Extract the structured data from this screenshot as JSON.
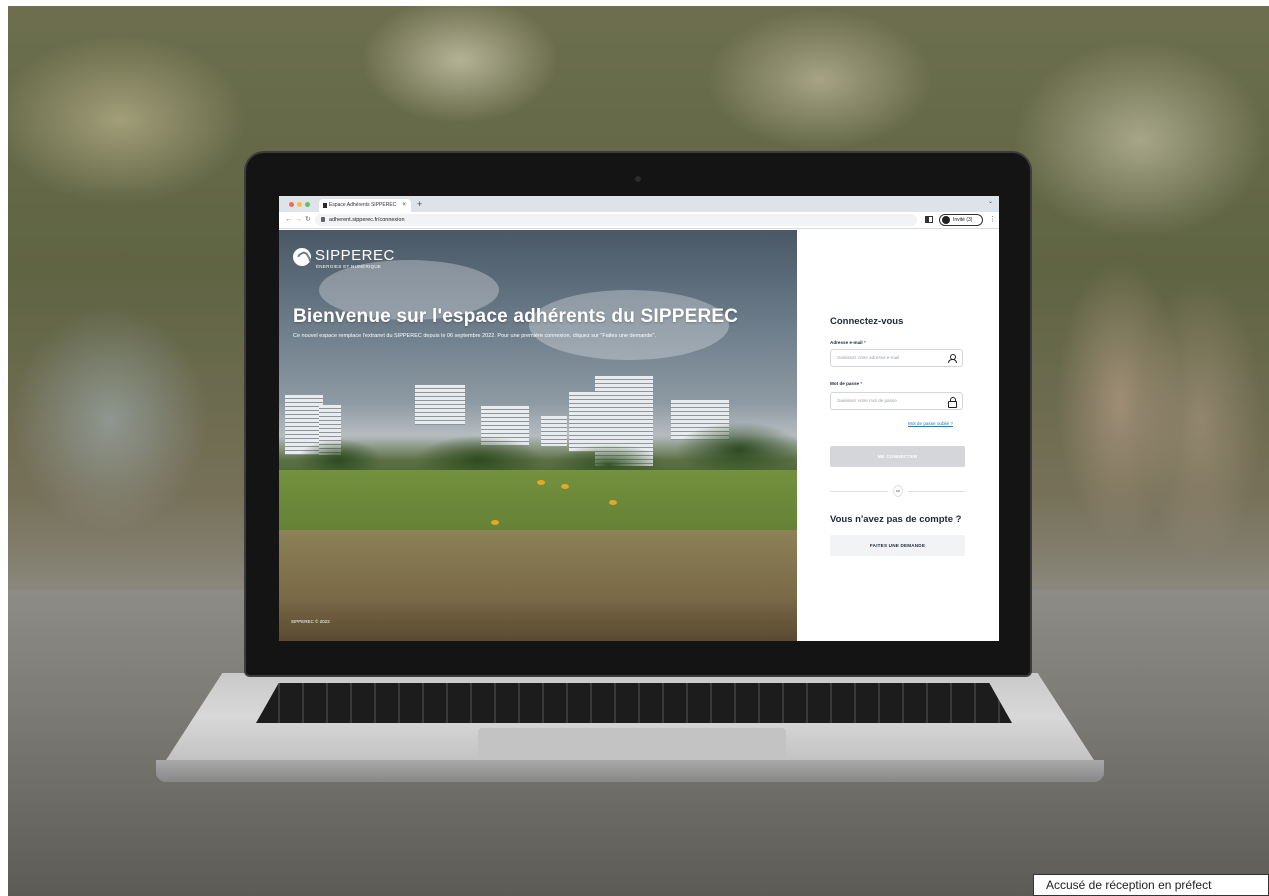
{
  "browser": {
    "tab_title": "Espace Adhérents SIPPEREC",
    "tab_close": "×",
    "new_tab": "+",
    "url": "adherent.sipperec.fr/connexion",
    "profile_label": "Invité (3)"
  },
  "hero": {
    "brand_name": "SIPPEREC",
    "brand_tagline": "ÉNERGIES ET NUMÉRIQUE",
    "title": "Bienvenue sur l'espace adhérents du SIPPEREC",
    "subtitle": "Ce nouvel espace remplace l'extranet du SIPPEREC depuis le 06 septembre 2022. Pour une première connexion, cliquez sur \"Faites une demande\".",
    "copyright": "SIPPEREC © 2023"
  },
  "login": {
    "title": "Connectez-vous",
    "email_label": "Adresse e-mail",
    "email_placeholder": "Saisissez votre adresse e-mail",
    "password_label": "Mot de passe",
    "password_placeholder": "Saisissez votre mot de passe",
    "required_mark": "*",
    "forgot_link": "Mot de passe oublié ?",
    "connect_button": "ME CONNECTER",
    "divider": "ou",
    "no_account_title": "Vous n'avez pas de compte ?",
    "request_button": "FAITES UNE DEMANDE"
  },
  "caption": "Accusé de réception en préfect",
  "colors": {
    "title_navy": "#1b2a3a",
    "link_blue": "#2b78b8",
    "disabled_button": "#d4d6d9",
    "required_red": "#d0342c"
  }
}
